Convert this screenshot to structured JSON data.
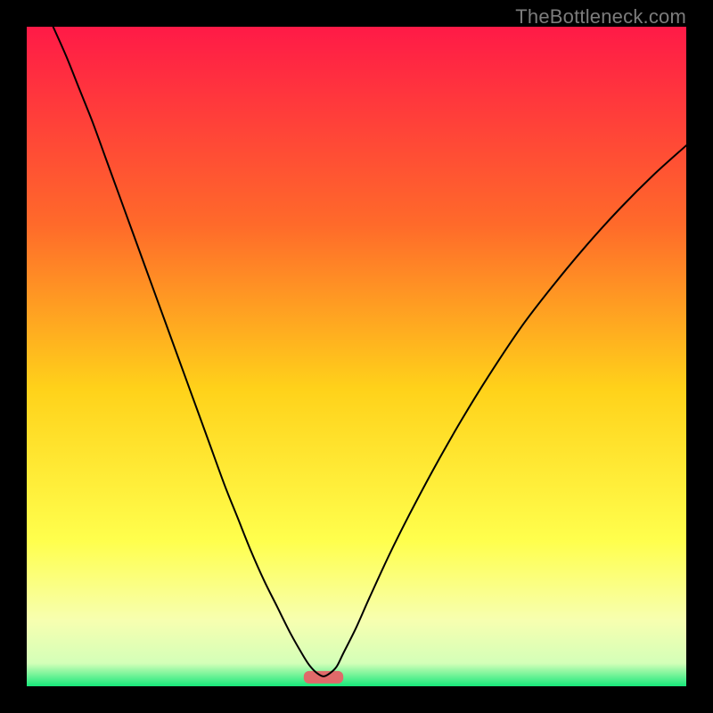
{
  "watermark": "TheBottleneck.com",
  "chart_data": {
    "type": "line",
    "title": "",
    "xlabel": "",
    "ylabel": "",
    "xlim": [
      0,
      100
    ],
    "ylim": [
      0,
      100
    ],
    "grid": false,
    "legend": false,
    "background_gradient": {
      "stops": [
        {
          "offset": 0.0,
          "color": "#ff1a47"
        },
        {
          "offset": 0.3,
          "color": "#ff6a2a"
        },
        {
          "offset": 0.55,
          "color": "#ffd21a"
        },
        {
          "offset": 0.78,
          "color": "#ffff4d"
        },
        {
          "offset": 0.9,
          "color": "#f7ffb0"
        },
        {
          "offset": 0.965,
          "color": "#d4ffb8"
        },
        {
          "offset": 1.0,
          "color": "#17e87a"
        }
      ]
    },
    "marker": {
      "x": 45,
      "y": 1.5,
      "width": 6,
      "color": "#e06a6a"
    },
    "series": [
      {
        "name": "curve",
        "color": "#000000",
        "stroke_width": 2,
        "x": [
          4,
          6,
          8,
          10,
          12,
          14,
          16,
          18,
          20,
          22,
          24,
          26,
          28,
          30,
          32,
          34,
          36,
          38,
          40,
          42,
          43,
          44,
          45,
          46,
          47,
          48,
          50,
          52,
          55,
          58,
          62,
          66,
          70,
          75,
          80,
          85,
          90,
          95,
          100
        ],
        "y": [
          100,
          95.5,
          90.5,
          85.5,
          80.0,
          74.5,
          69.0,
          63.5,
          58.0,
          52.5,
          47.0,
          41.5,
          36.0,
          30.5,
          25.5,
          20.5,
          16.0,
          12.0,
          8.0,
          4.5,
          3.0,
          2.0,
          1.5,
          2.0,
          3.0,
          5.0,
          9.0,
          13.5,
          20.0,
          26.0,
          33.5,
          40.5,
          47.0,
          54.5,
          61.0,
          67.0,
          72.5,
          77.5,
          82.0
        ]
      }
    ]
  }
}
